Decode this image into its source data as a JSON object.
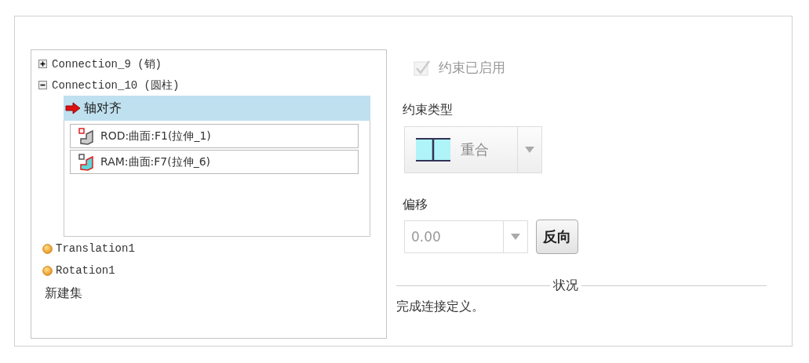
{
  "tree": {
    "connections": [
      {
        "label": "Connection_9 (销)",
        "expanded": false
      },
      {
        "label": "Connection_10 (圆柱)",
        "expanded": true,
        "children": [
          {
            "label": "轴对齐",
            "selected": true,
            "references": [
              {
                "label": "ROD:曲面:F1(拉伸_1)"
              },
              {
                "label": "RAM:曲面:F7(拉伸_6)"
              }
            ]
          }
        ]
      }
    ],
    "motion_axes": [
      {
        "label": "Translation1"
      },
      {
        "label": "Rotation1"
      }
    ],
    "new_set": "新建集"
  },
  "constraint_enabled": {
    "label": "约束已启用",
    "checked": true,
    "disabled": true
  },
  "constraint_type": {
    "label": "约束类型",
    "value": "重合"
  },
  "offset": {
    "label": "偏移",
    "value": "0.00",
    "button": "反向"
  },
  "status": {
    "label": "状况",
    "message": "完成连接定义。"
  }
}
